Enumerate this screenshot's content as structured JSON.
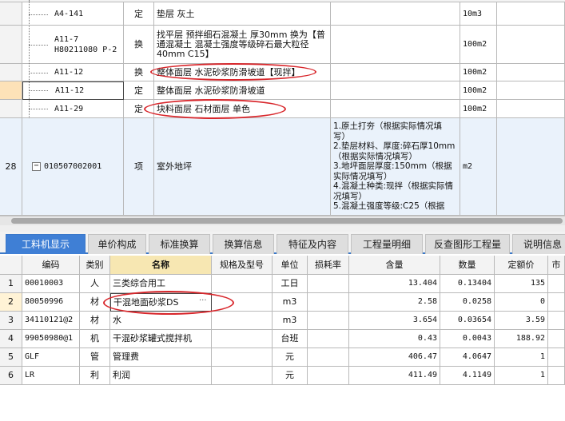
{
  "top_rows": [
    {
      "row_num": "",
      "code": "A4-141",
      "type": "定",
      "name": "垫层 灰土",
      "feature": "",
      "unit": "10m3"
    },
    {
      "row_num": "",
      "code": "A11-7\nH80211080 P-2",
      "type": "换",
      "name": "找平层 预拌细石混凝土 厚30mm 换为【普通混凝土 混凝土强度等级碎石最大粒径40mm C15】",
      "feature": "",
      "unit": "100m2"
    },
    {
      "row_num": "",
      "code": "A11-12",
      "type": "换",
      "name": "整体面层 水泥砂浆防滑坡道【现拌】",
      "feature": "",
      "unit": "100m2"
    },
    {
      "row_num": "",
      "code": "A11-12",
      "type": "定",
      "name": "整体面层 水泥砂浆防滑坡道",
      "feature": "",
      "unit": "100m2"
    },
    {
      "row_num": "",
      "code": "A11-29",
      "type": "定",
      "name": "块料面层 石材面层 单色",
      "feature": "",
      "unit": "100m2"
    },
    {
      "row_num": "28",
      "code": "010507002001",
      "type": "项",
      "name": "室外地坪",
      "feature": "1.原土打夯（根据实际情况填写）\n2.垫层材料、厚度:碎石厚10mm（根据实际情况填写）\n3.地坪面层厚度:150mm（根据实际情况填写）\n4.混凝土种类:现拌（根据实际情况填写）\n5.混凝土强度等级:C25（根据",
      "unit": "m2"
    }
  ],
  "tabs": [
    {
      "label": "工料机显示",
      "active": true
    },
    {
      "label": "单价构成"
    },
    {
      "label": "标准换算"
    },
    {
      "label": "换算信息"
    },
    {
      "label": "特征及内容"
    },
    {
      "label": "工程量明细"
    },
    {
      "label": "反查图形工程量"
    },
    {
      "label": "说明信息"
    }
  ],
  "columns": {
    "code": "编码",
    "category": "类别",
    "name": "名称",
    "spec": "规格及型号",
    "unit": "单位",
    "loss": "损耗率",
    "content": "含量",
    "qty": "数量",
    "price": "定额价",
    "market": "市"
  },
  "rows": [
    {
      "num": "1",
      "code": "00010003",
      "category": "人",
      "name": "三类综合用工",
      "spec": "",
      "unit": "工日",
      "loss": "",
      "content": "13.404",
      "qty": "0.13404",
      "price": "135"
    },
    {
      "num": "2",
      "code": "80050996",
      "category": "材",
      "name": "干混地面砂浆DS",
      "spec": "",
      "unit": "m3",
      "loss": "",
      "content": "2.58",
      "qty": "0.0258",
      "price": "0"
    },
    {
      "num": "3",
      "code": "34110121@2",
      "category": "材",
      "name": "水",
      "spec": "",
      "unit": "m3",
      "loss": "",
      "content": "3.654",
      "qty": "0.03654",
      "price": "3.59"
    },
    {
      "num": "4",
      "code": "99050980@1",
      "category": "机",
      "name": "干混砂浆罐式搅拌机",
      "spec": "",
      "unit": "台班",
      "loss": "",
      "content": "0.43",
      "qty": "0.0043",
      "price": "188.92"
    },
    {
      "num": "5",
      "code": "GLF",
      "category": "管",
      "name": "管理费",
      "spec": "",
      "unit": "元",
      "loss": "",
      "content": "406.47",
      "qty": "4.0647",
      "price": "1"
    },
    {
      "num": "6",
      "code": "LR",
      "category": "利",
      "name": "利润",
      "spec": "",
      "unit": "元",
      "loss": "",
      "content": "411.49",
      "qty": "4.1149",
      "price": "1"
    }
  ],
  "ellipsis": "···",
  "colors": {
    "tab_active": "#3f7fd5",
    "annotation": "#d8262b",
    "name_header": "#f7e7b2"
  }
}
